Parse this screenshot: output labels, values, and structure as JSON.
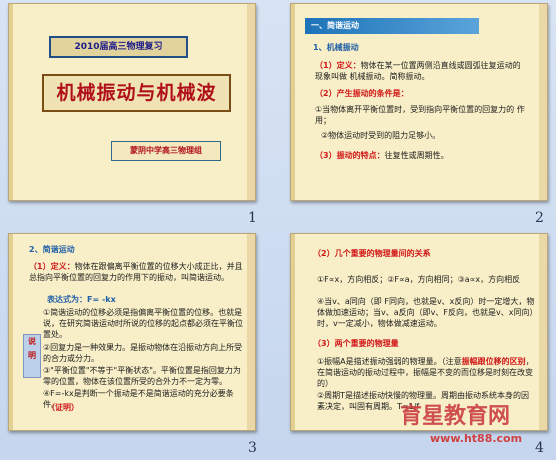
{
  "slide1": {
    "tag": "2010届高三物理复习",
    "title": "机械振动与机械波",
    "author": "蒙阴中学高三物理组",
    "number": "1"
  },
  "slide2": {
    "heading": "一、简谐运动",
    "sub1": "1、机械振动",
    "def_label": "（1）定义：",
    "def_text": "物体在某一位置两侧沿直线或圆弧往复运动的现象叫做 机械振动。简称振动。",
    "cond_label": "（2）产生振动的条件是：",
    "cond1": "①当物体离开平衡位置时，受到指向平衡位置的回复力的 作用；",
    "cond2": "②物体运动时受到的阻力足够小。",
    "feat_label": "（3）振动的特点：",
    "feat_text": "往复性或周期性。",
    "number": "2"
  },
  "slide3": {
    "heading": "2、简谐运动",
    "def_label": "（1）定义：",
    "def_text": "物体在跟偏离平衡位置的位移大小成正比，并且总指向平衡位置的回复力的作用下的振动，叫简谐运动。",
    "formula": "表达式为：F= -kx",
    "note1": "①简谐运动的位移必须是指偏离平衡位置的位移。也就是说，在研究简谐运动时所说的位移的起点都必须在平衡位置处。",
    "note2": "②回复力是一种效果力。是振动物体在沿振动方向上所受的合力或分力。",
    "note3": "③\"平衡位置\"不等于\"平衡状态\"。平衡位置是指回复力为零的位置，物体在该位置所受的合外力不一定为零。",
    "note4": "④F=-kx是判断一个振动是不是简谐运动的充分必要条件。",
    "proof": "（证明）",
    "side_a": "说",
    "side_b": "明",
    "number": "3"
  },
  "slide4": {
    "heading": "（2）几个重要的物理量间的关系",
    "rel1": "①F∝x，方向相反；②F∝a，方向相同；③a∝x，方向相反",
    "rel2": "④当v、a同向（即 F同向，也就是v、x反向）时一定增大，物体做加速运动；当v、a反向（即v、F反向，也就是v、x同向）时，v一定减小，物体做减速运动。",
    "heading2": "（3）两个重要的物理量",
    "q1a": "①振幅A是描述振动强弱的物理量。（注意",
    "q1b": "振幅跟位移的区别",
    "q1c": "，在简谐运动的振动过程中，振幅是不变的而位移是时刻在改变的）",
    "q2": "②周期T是描述振动快慢的物理量。周期由振动系统本身的因素决定，叫固有周期。T=1/f",
    "number": "4"
  },
  "watermark": {
    "line1": "育星教育网",
    "line2": "www.ht88.com"
  }
}
